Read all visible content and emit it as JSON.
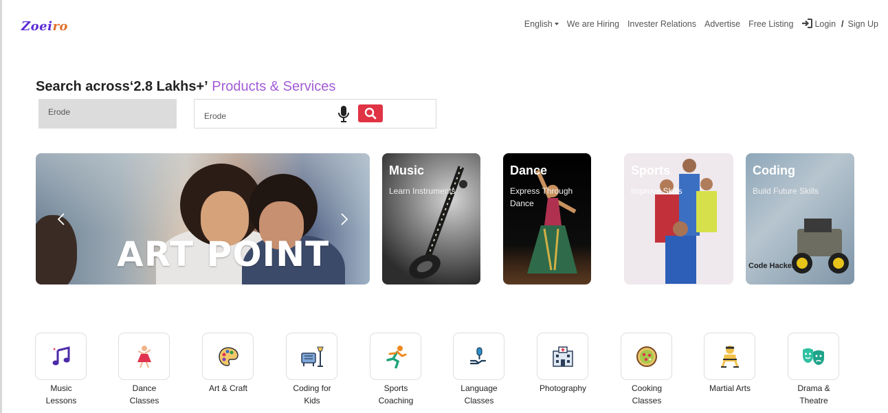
{
  "header": {
    "logo_part1": "Zoei",
    "logo_part2": "ro",
    "nav": {
      "language": "English",
      "hiring": "We are Hiring",
      "investor": "Invester Relations",
      "advertise": "Advertise",
      "free_listing": "Free Listing",
      "login": "Login",
      "separator": "/",
      "signup": "Sign Up"
    }
  },
  "search": {
    "headline_bold": "Search across‘2.8 Lakhs+’",
    "headline_accent": "Products & Services",
    "city_value": "Erode",
    "query_value": "Erode"
  },
  "banners": {
    "hero_title": "ART POINT",
    "cards": [
      {
        "title": "Music",
        "subtitle": "Learn Instruments"
      },
      {
        "title": "Dance",
        "subtitle": "Express Through Dance"
      },
      {
        "title": "Sports",
        "subtitle": "Improve Skills"
      },
      {
        "title": "Coding",
        "subtitle": "Build Future Skills",
        "extra": "Code Hacker"
      }
    ]
  },
  "categories": [
    {
      "label": "Music Lessons",
      "icon": "music-notes-icon"
    },
    {
      "label": "Dance Classes",
      "icon": "dancer-icon"
    },
    {
      "label": "Art & Craft",
      "icon": "palette-icon"
    },
    {
      "label": "Coding for Kids",
      "icon": "desk-lamp-icon"
    },
    {
      "label": "Sports Coaching",
      "icon": "runner-icon"
    },
    {
      "label": "Language Classes",
      "icon": "microphone-hand-icon"
    },
    {
      "label": "Photography",
      "icon": "hospital-building-icon"
    },
    {
      "label": "Cooking Classes",
      "icon": "pizza-icon"
    },
    {
      "label": "Martial Arts",
      "icon": "martial-artist-icon"
    },
    {
      "label": "Drama & Theatre",
      "icon": "theatre-masks-icon"
    }
  ],
  "colors": {
    "accent_purple": "#a35bd6",
    "search_red": "#e03344",
    "logo_purple": "#5b2bd6",
    "logo_orange": "#e0702a"
  }
}
